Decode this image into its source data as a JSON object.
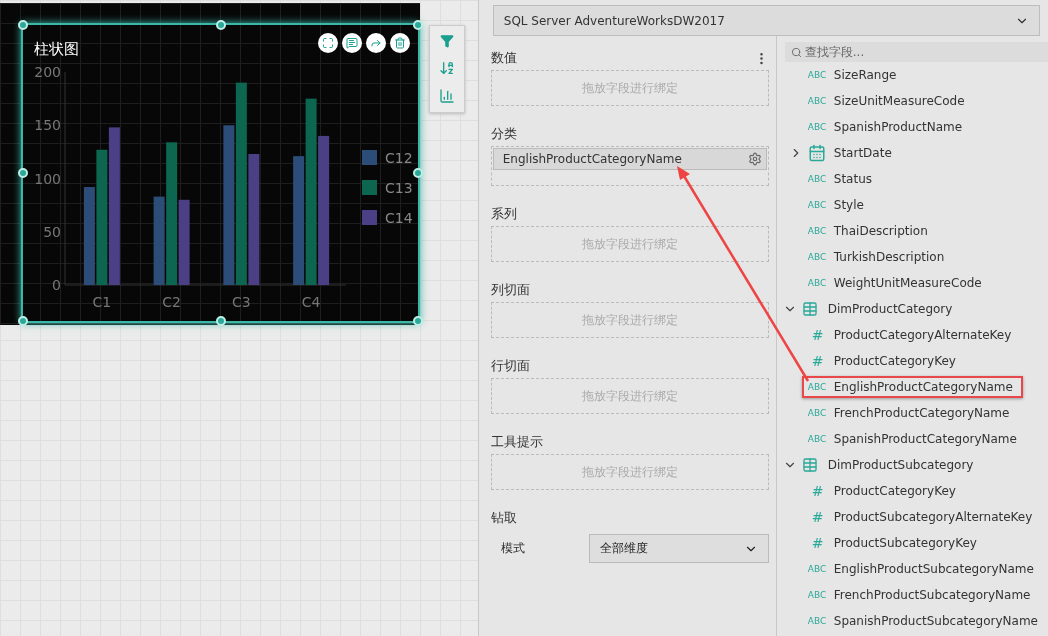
{
  "chart_widget": {
    "title": "柱状图",
    "chart_data": {
      "type": "bar",
      "categories": [
        "C1",
        "C2",
        "C3",
        "C4"
      ],
      "series": [
        {
          "name": "C12",
          "color": "#2c4d78",
          "values": [
            92,
            83,
            150,
            121
          ]
        },
        {
          "name": "C13",
          "color": "#0c6650",
          "values": [
            127,
            134,
            190,
            175
          ]
        },
        {
          "name": "C14",
          "color": "#4b4085",
          "values": [
            148,
            80,
            123,
            140
          ]
        }
      ],
      "legend": "right",
      "ylim": [
        0,
        200
      ],
      "yticks": [
        0,
        50,
        100,
        150,
        200
      ]
    }
  },
  "data_source": {
    "value": "SQL Server AdventureWorksDW2017"
  },
  "bindings": [
    {
      "label": "数值",
      "has_menu": true,
      "hint": "拖放字段进行绑定"
    },
    {
      "label": "分类",
      "has_menu": false,
      "bound_field": "EnglishProductCategoryName"
    },
    {
      "label": "系列",
      "has_menu": false,
      "hint": "拖放字段进行绑定"
    },
    {
      "label": "列切面",
      "has_menu": false,
      "hint": "拖放字段进行绑定"
    },
    {
      "label": "行切面",
      "has_menu": false,
      "hint": "拖放字段进行绑定"
    },
    {
      "label": "工具提示",
      "has_menu": false,
      "hint": "拖放字段进行绑定"
    }
  ],
  "drill": {
    "label": "钻取",
    "mode_label": "模式",
    "mode_value": "全部维度"
  },
  "field_search": {
    "placeholder": "查找字段..."
  },
  "tree": [
    {
      "kind": "text",
      "type_label": "ABC",
      "name": "SizeRange"
    },
    {
      "kind": "text",
      "type_label": "ABC",
      "name": "SizeUnitMeasureCode"
    },
    {
      "kind": "text",
      "type_label": "ABC",
      "name": "SpanishProductName"
    },
    {
      "kind": "date",
      "name": "StartDate",
      "expanded": false
    },
    {
      "kind": "text",
      "type_label": "ABC",
      "name": "Status"
    },
    {
      "kind": "text",
      "type_label": "ABC",
      "name": "Style"
    },
    {
      "kind": "text",
      "type_label": "ABC",
      "name": "ThaiDescription"
    },
    {
      "kind": "text",
      "type_label": "ABC",
      "name": "TurkishDescription"
    },
    {
      "kind": "text",
      "type_label": "ABC",
      "name": "WeightUnitMeasureCode"
    },
    {
      "kind": "table",
      "name": "DimProductCategory",
      "expanded": true,
      "children": [
        {
          "kind": "number",
          "type_label": "#",
          "name": "ProductCategoryAlternateKey",
          "highlighted": false
        },
        {
          "kind": "number",
          "type_label": "#",
          "name": "ProductCategoryKey",
          "highlighted": false
        },
        {
          "kind": "text",
          "type_label": "ABC",
          "name": "EnglishProductCategoryName",
          "highlighted": true
        },
        {
          "kind": "text",
          "type_label": "ABC",
          "name": "FrenchProductCategoryName",
          "highlighted": false
        },
        {
          "kind": "text",
          "type_label": "ABC",
          "name": "SpanishProductCategoryName",
          "highlighted": false
        }
      ]
    },
    {
      "kind": "table",
      "name": "DimProductSubcategory",
      "expanded": true,
      "children": [
        {
          "kind": "number",
          "type_label": "#",
          "name": "ProductCategoryKey"
        },
        {
          "kind": "number",
          "type_label": "#",
          "name": "ProductSubcategoryAlternateKey"
        },
        {
          "kind": "number",
          "type_label": "#",
          "name": "ProductSubcategoryKey"
        },
        {
          "kind": "text",
          "type_label": "ABC",
          "name": "EnglishProductSubcategoryName"
        },
        {
          "kind": "text",
          "type_label": "ABC",
          "name": "FrenchProductSubcategoryName"
        },
        {
          "kind": "text",
          "type_label": "ABC",
          "name": "SpanishProductSubcategoryName"
        }
      ]
    }
  ]
}
